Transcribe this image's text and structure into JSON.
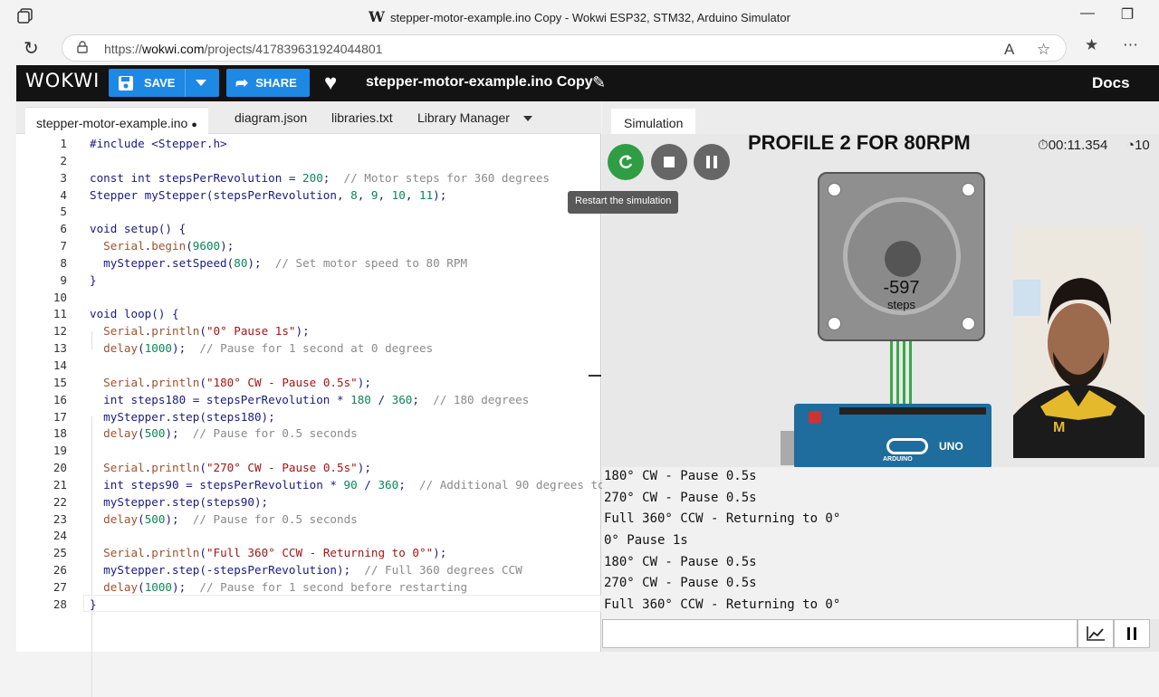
{
  "browser": {
    "title": "stepper-motor-example.ino Copy - Wokwi ESP32, STM32, Arduino Simulator",
    "title_logo": "W",
    "url_prefix": "https://",
    "url_host": "wokwi.com",
    "url_path": "/projects/417839631924044801"
  },
  "wokwi": {
    "logo": "WOKWI",
    "save_label": "SAVE",
    "share_label": "SHARE",
    "project_title": "stepper-motor-example.ino Copy",
    "docs_label": "Docs"
  },
  "editor": {
    "tabs": [
      "stepper-motor-example.ino",
      "diagram.json",
      "libraries.txt",
      "Library Manager"
    ],
    "modified_dot": "●"
  },
  "simulation": {
    "tab_label": "Simulation",
    "tooltip": "Restart the simulation",
    "profile_title": "PROFILE 2 FOR 80RPM",
    "timer": "00:11.354",
    "speed_partial": "10",
    "motor_steps": "-597",
    "motor_steps_label": "steps",
    "board_label": "UNO",
    "board_brand": "ARDUINO"
  },
  "serial_lines": [
    "180° CW - Pause 0.5s",
    "270° CW - Pause 0.5s",
    "Full 360° CCW - Returning to 0°",
    "0° Pause 1s",
    "180° CW - Pause 0.5s",
    "270° CW - Pause 0.5s",
    "Full 360° CCW - Returning to 0°"
  ],
  "colors": {
    "accent_blue": "#1e88e5",
    "restart_green": "#2e9d44",
    "wokwi_bar": "#131313"
  },
  "icons": [
    "restart-icon",
    "stop-icon",
    "pause-icon",
    "stopwatch-icon",
    "speedometer-icon",
    "heart-icon",
    "pencil-icon",
    "chart-icon"
  ]
}
